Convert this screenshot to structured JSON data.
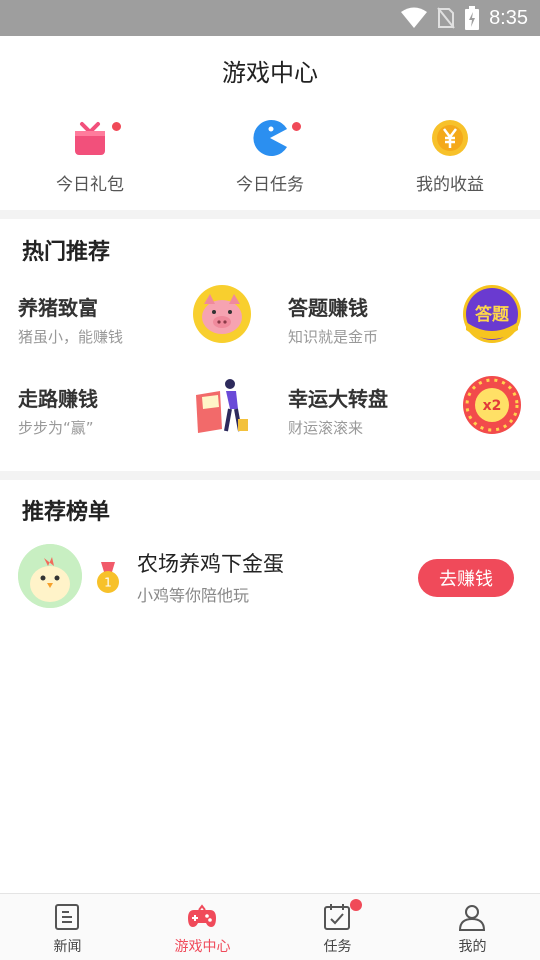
{
  "status_bar": {
    "time": "8:35"
  },
  "header": {
    "title": "游戏中心"
  },
  "quick_actions": [
    {
      "label": "今日礼包",
      "icon": "gift-icon",
      "badge": true
    },
    {
      "label": "今日任务",
      "icon": "pacman-icon",
      "badge": true
    },
    {
      "label": "我的收益",
      "icon": "yuan-coin-icon",
      "badge": false
    }
  ],
  "hot": {
    "title": "热门推荐",
    "items": [
      {
        "title": "养猪致富",
        "subtitle": "猪虽小，能赚钱",
        "icon": "pig-icon"
      },
      {
        "title": "答题赚钱",
        "subtitle": "知识就是金币",
        "icon": "quiz-badge-icon",
        "icon_text": "答题"
      },
      {
        "title": "走路赚钱",
        "subtitle": "步步为“赢”",
        "icon": "walking-man-icon"
      },
      {
        "title": "幸运大转盘",
        "subtitle": "财运滚滚来",
        "icon": "lucky-wheel-icon",
        "icon_text": "x2"
      }
    ]
  },
  "rank": {
    "title": "推荐榜单",
    "items": [
      {
        "rank": "1",
        "title": "农场养鸡下金蛋",
        "subtitle": "小鸡等你陪他玩",
        "button": "去赚钱"
      }
    ]
  },
  "bottom_nav": [
    {
      "label": "新闻",
      "icon": "news-icon",
      "active": false
    },
    {
      "label": "游戏中心",
      "icon": "gamepad-icon",
      "active": true
    },
    {
      "label": "任务",
      "icon": "task-calendar-icon",
      "active": false,
      "badge": true
    },
    {
      "label": "我的",
      "icon": "person-icon",
      "active": false
    }
  ],
  "colors": {
    "accent": "#f04a5a",
    "status_bar": "#9e9e9e",
    "separator": "#f3f3f3"
  }
}
